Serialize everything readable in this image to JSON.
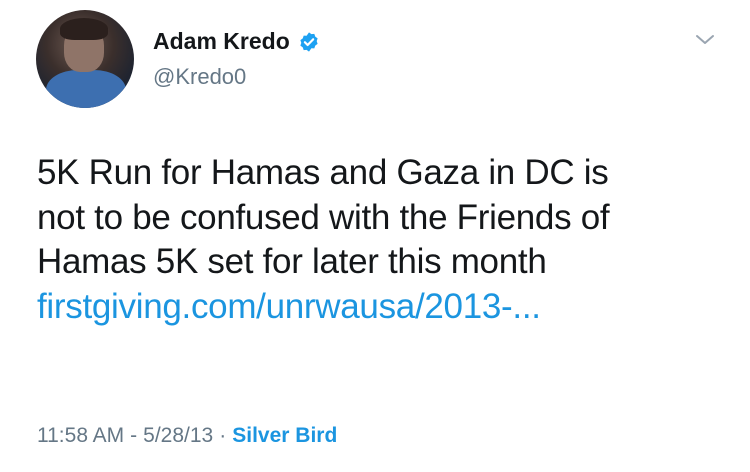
{
  "tweet": {
    "author": {
      "display_name": "Adam Kredo",
      "handle": "@Kredo0",
      "verified": true
    },
    "text_lines": [
      "5K Run for Hamas and Gaza in DC is",
      "not to be confused with the Friends of",
      "Hamas 5K set for later this month"
    ],
    "link_text": "firstgiving.com/unrwausa/2013-...",
    "time": "11:58 AM",
    "date": "5/28/13",
    "separator": "-",
    "source": "Silver Bird"
  },
  "colors": {
    "link": "#1b95e0",
    "muted": "#657786",
    "text": "#14171a",
    "verified_badge": "#1da1f2"
  },
  "icons": {
    "verified": "verified-badge-icon",
    "more": "chevron-down-icon"
  }
}
